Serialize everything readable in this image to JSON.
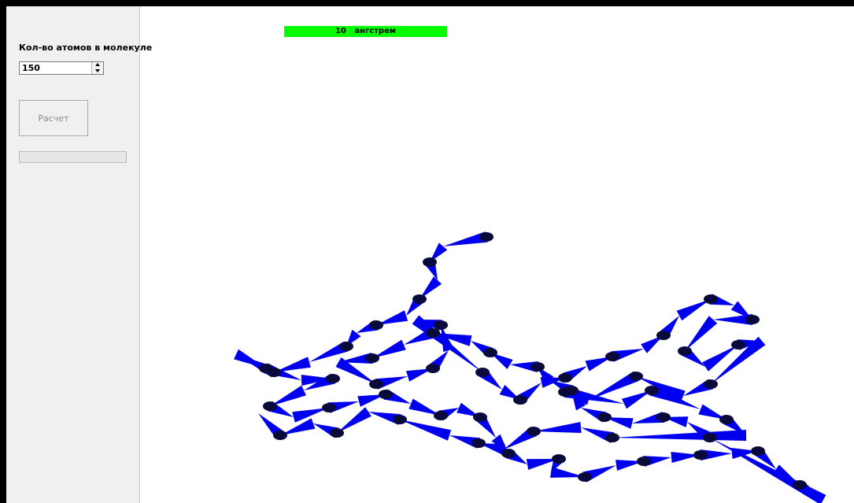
{
  "panel": {
    "atoms_label": "Кол-во атомов в молекуле",
    "atoms_value": "150",
    "calculate_label": "Расчет",
    "progress_fraction": 0
  },
  "scale": {
    "value": "10",
    "unit": "ангстрем",
    "bar_color": "#00ff00"
  },
  "colors": {
    "bond": "#0000ee",
    "atom": "#0a0a3a"
  }
}
